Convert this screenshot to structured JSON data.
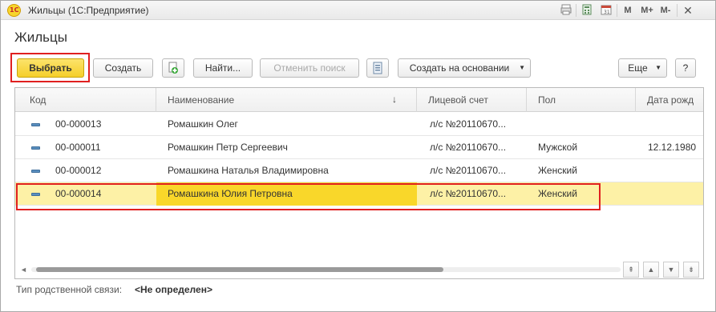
{
  "window": {
    "title": "Жильцы  (1С:Предприятие)",
    "logo_text": "1С",
    "titlebar_icons": {
      "m": "M",
      "mplus": "M+",
      "mminus": "M-"
    }
  },
  "form": {
    "title": "Жильцы"
  },
  "toolbar": {
    "select_label": "Выбрать",
    "create_label": "Создать",
    "find_label": "Найти...",
    "cancel_search_label": "Отменить поиск",
    "create_based_label": "Создать на основании",
    "more_label": "Еще",
    "help_label": "?"
  },
  "table": {
    "columns": [
      "Код",
      "Наименование",
      "Лицевой счет",
      "Пол",
      "Дата рожд"
    ],
    "sort_indicator": "↓",
    "rows": [
      {
        "code": "00-000013",
        "name": "Ромашкин Олег",
        "account": "л/с №20110670...",
        "gender": "",
        "birth": ""
      },
      {
        "code": "00-000011",
        "name": "Ромашкин Петр Сергеевич",
        "account": "л/с №20110670...",
        "gender": "Мужской",
        "birth": "12.12.1980"
      },
      {
        "code": "00-000012",
        "name": "Ромашкина Наталья Владимировна",
        "account": "л/с №20110670...",
        "gender": "Женский",
        "birth": ""
      },
      {
        "code": "00-000014",
        "name": "Ромашкина Юлия Петровна",
        "account": "л/с №20110670...",
        "gender": "Женский",
        "birth": ""
      }
    ],
    "selected_row": 3
  },
  "footer": {
    "relation_label": "Тип родственной связи:",
    "relation_value": "<Не определен>"
  },
  "colors": {
    "primary_button": "#f5cf2a",
    "selection_row": "#fdf1a6",
    "selection_cell": "#f9d72a",
    "annotation_frame": "#e02020"
  }
}
